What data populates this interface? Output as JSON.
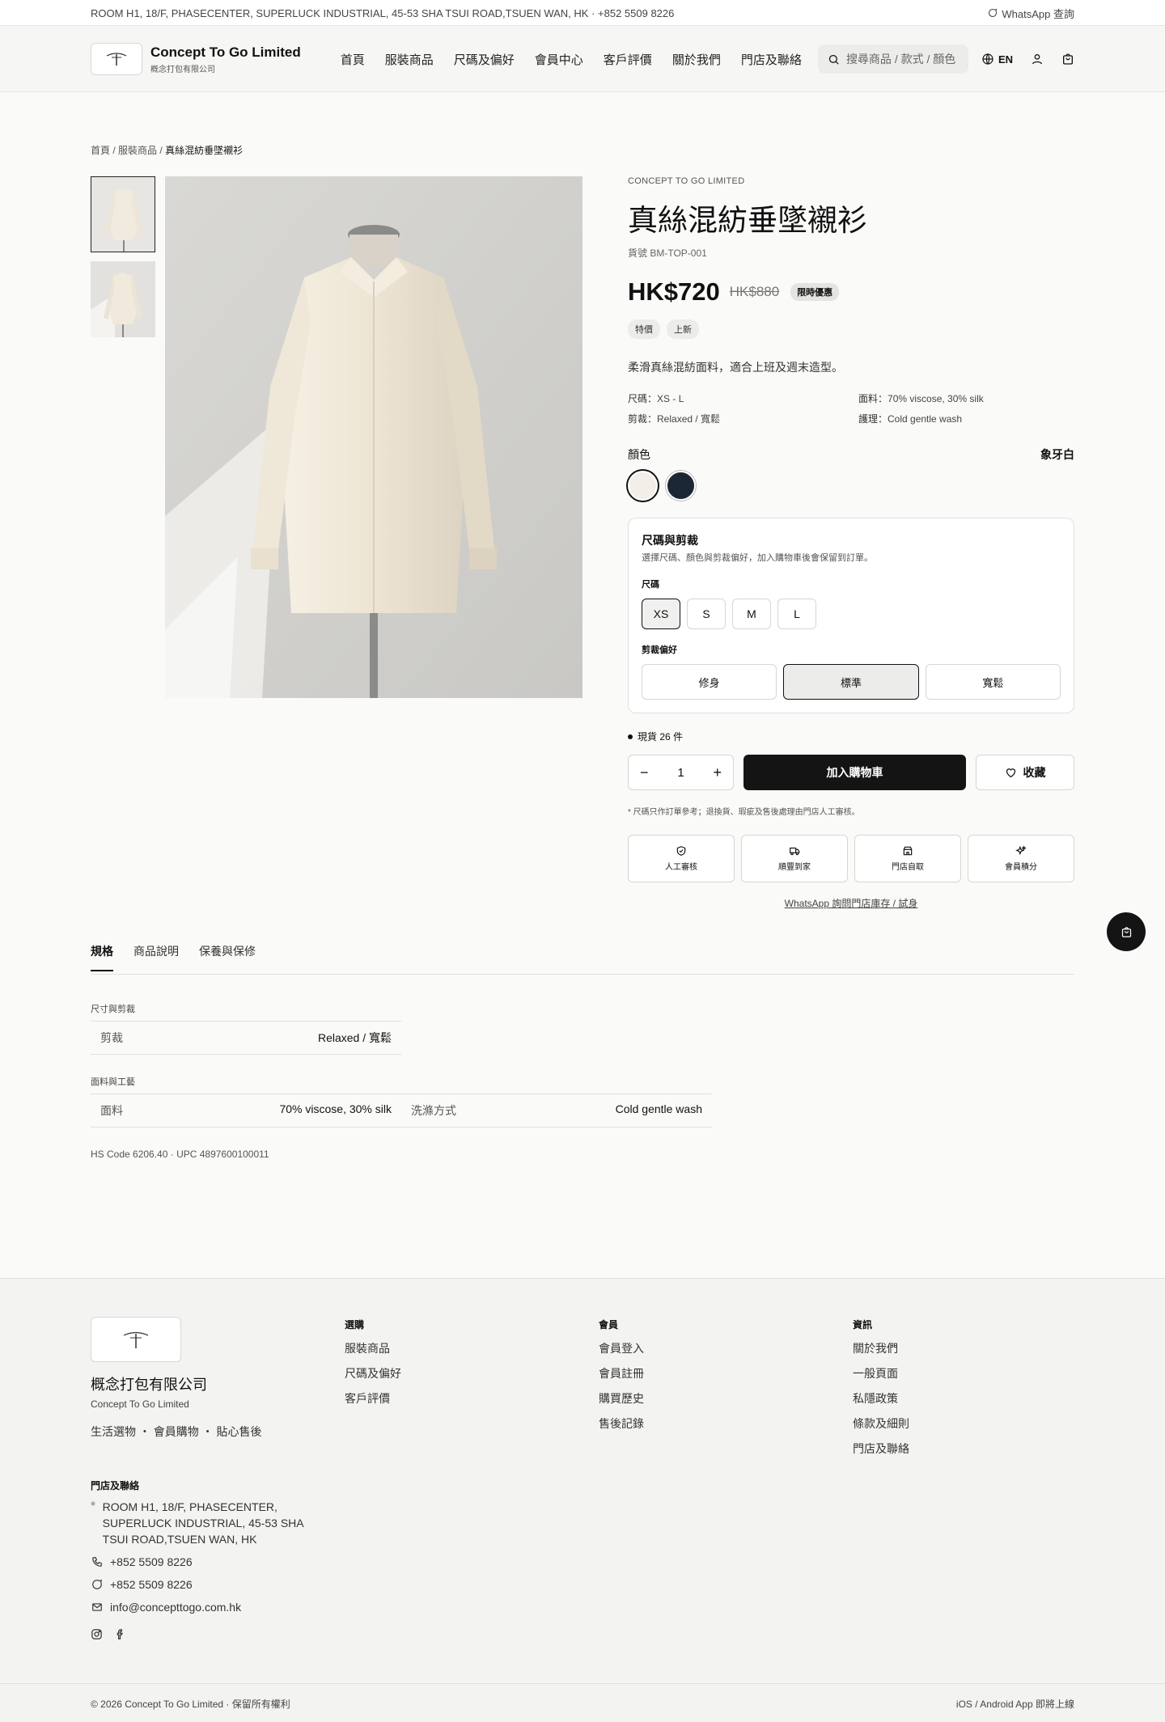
{
  "topbar": {
    "address": "ROOM H1, 18/F, PHASECENTER, SUPERLUCK INDUSTRIAL, 45-53 SHA TSUI ROAD,TSUEN WAN, HK · +852 5509 8226",
    "whatsapp": "WhatsApp 查詢"
  },
  "header": {
    "brand_en": "Concept To Go Limited",
    "brand_zh": "概念打包有限公司",
    "nav": [
      "首頁",
      "服裝商品",
      "尺碼及偏好",
      "會員中心",
      "客戶評價",
      "關於我們",
      "門店及聯絡"
    ],
    "search_placeholder": "搜尋商品 / 款式 / 顏色",
    "lang": "EN"
  },
  "breadcrumb": {
    "home": "首頁",
    "category": "服裝商品",
    "current": "真絲混紡垂墜襯衫"
  },
  "product": {
    "maker": "CONCEPT TO GO LIMITED",
    "title": "真絲混紡垂墜襯衫",
    "sku": "貨號 BM-TOP-001",
    "price": "HK$720",
    "old_price": "HK$880",
    "promo": "限時優惠",
    "tags": [
      "特價",
      "上新"
    ],
    "description": "柔滑真絲混紡面料，適合上班及週末造型。",
    "specs": {
      "size_label": "尺碼：",
      "size_value": "XS - L",
      "fabric_label": "面料：",
      "fabric_value": "70% viscose, 30% silk",
      "fit_label": "剪裁：",
      "fit_value": "Relaxed / 寬鬆",
      "care_label": "護理：",
      "care_value": "Cold gentle wash"
    },
    "color_label": "顏色",
    "selected_color": "象牙白",
    "colors": [
      "#f3efe8",
      "#1c2736"
    ]
  },
  "size_panel": {
    "title": "尺碼與剪裁",
    "subtitle": "選擇尺碼、顏色與剪裁偏好，加入購物車後會保留到訂單。",
    "size_label": "尺碼",
    "sizes": [
      "XS",
      "S",
      "M",
      "L"
    ],
    "selected_size": "XS",
    "fit_label": "剪裁偏好",
    "fits": [
      "修身",
      "標準",
      "寬鬆"
    ],
    "selected_fit": "標準"
  },
  "purchase": {
    "stock": "現貨 26 件",
    "qty_minus": "−",
    "qty": "1",
    "qty_plus": "+",
    "add_to_cart": "加入購物車",
    "favorite": "收藏",
    "note": "* 尺碼只作訂單參考；退換貨、瑕疵及售後處理由門店人工審核。",
    "features": [
      "人工審核",
      "順豐到家",
      "門店自取",
      "會員積分"
    ],
    "whatsapp_link": "WhatsApp 詢問門店庫存 / 試身"
  },
  "details": {
    "tabs": [
      "規格",
      "商品說明",
      "保養與保修"
    ],
    "section1": "尺寸與剪裁",
    "fit_key": "剪裁",
    "fit_val": "Relaxed / 寬鬆",
    "section2": "面料與工藝",
    "fabric_key": "面料",
    "fabric_val": "70% viscose, 30% silk",
    "wash_key": "洗滌方式",
    "wash_val": "Cold gentle wash",
    "codes": "HS Code 6206.40 · UPC 4897600100011"
  },
  "footer": {
    "name_zh": "概念打包有限公司",
    "name_en": "Concept To Go Limited",
    "slogan": "生活選物 ・ 會員購物 ・ 貼心售後",
    "col1_title": "選購",
    "col1": [
      "服裝商品",
      "尺碼及偏好",
      "客戶評價"
    ],
    "col2_title": "會員",
    "col2": [
      "會員登入",
      "會員註冊",
      "購買歷史",
      "售後記錄"
    ],
    "col3_title": "資訊",
    "col3": [
      "關於我們",
      "一般頁面",
      "私隱政策",
      "條款及細則",
      "門店及聯絡"
    ],
    "contact_title": "門店及聯絡",
    "address": "ROOM H1, 18/F, PHASECENTER, SUPERLUCK INDUSTRIAL, 45-53 SHA TSUI ROAD,TSUEN WAN, HK",
    "phone": "+852 5509 8226",
    "whatsapp": "+852 5509 8226",
    "email": "info@concepttogo.com.hk",
    "copyright": "© 2026 Concept To Go Limited · 保留所有權利",
    "app_note": "iOS / Android App 即將上線"
  }
}
